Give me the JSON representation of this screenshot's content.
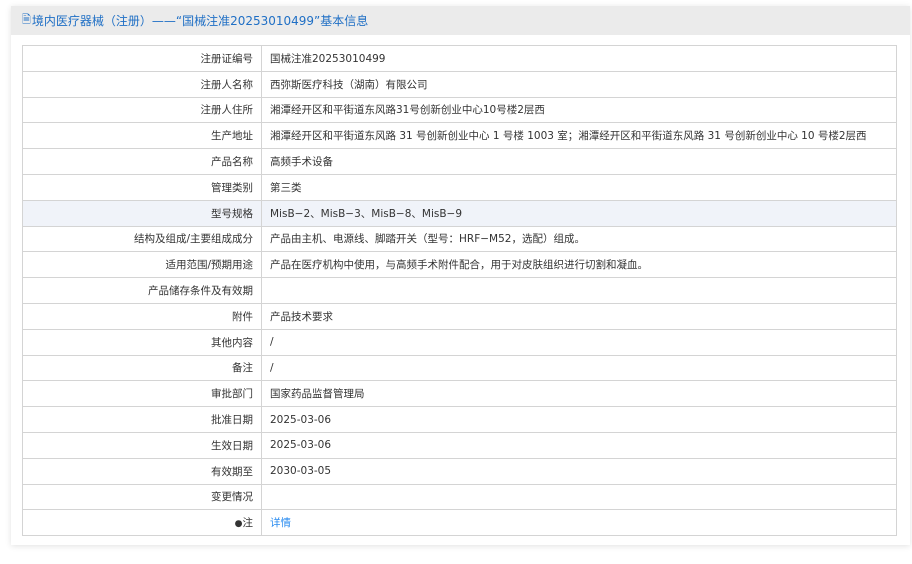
{
  "header": {
    "icon": "document-icon",
    "title": "境内医疗器械（注册）——“国械注准20253010499”基本信息"
  },
  "rows": [
    {
      "label": "注册证编号",
      "value": "国械注准20253010499"
    },
    {
      "label": "注册人名称",
      "value": "西弥斯医疗科技（湖南）有限公司"
    },
    {
      "label": "注册人住所",
      "value": "湘潭经开区和平街道东风路31号创新创业中心10号楼2层西"
    },
    {
      "label": "生产地址",
      "value": "湘潭经开区和平街道东风路 31 号创新创业中心 1 号楼 1003 室；湘潭经开区和平街道东风路 31 号创新创业中心 10 号楼2层西"
    },
    {
      "label": "产品名称",
      "value": "高频手术设备"
    },
    {
      "label": "管理类别",
      "value": "第三类"
    },
    {
      "label": "型号规格",
      "value": "MisB−2、MisB−3、MisB−8、MisB−9"
    },
    {
      "label": "结构及组成/主要组成成分",
      "value": "产品由主机、电源线、脚踏开关（型号：HRF−M52，选配）组成。"
    },
    {
      "label": "适用范围/预期用途",
      "value": "产品在医疗机构中使用，与高频手术附件配合，用于对皮肤组织进行切割和凝血。"
    },
    {
      "label": "产品储存条件及有效期",
      "value": ""
    },
    {
      "label": "附件",
      "value": "产品技术要求"
    },
    {
      "label": "其他内容",
      "value": "/"
    },
    {
      "label": "备注",
      "value": "/"
    },
    {
      "label": "审批部门",
      "value": "国家药品监督管理局"
    },
    {
      "label": "批准日期",
      "value": "2025-03-06"
    },
    {
      "label": "生效日期",
      "value": "2025-03-06"
    },
    {
      "label": "有效期至",
      "value": "2030-03-05"
    },
    {
      "label": "变更情况",
      "value": ""
    }
  ],
  "note": {
    "label": "注",
    "icon": "lightbulb-icon",
    "link": "详情"
  }
}
